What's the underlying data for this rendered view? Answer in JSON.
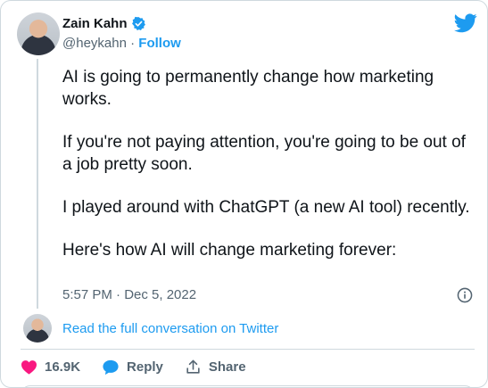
{
  "author": {
    "name": "Zain Kahn",
    "handle": "@heykahn",
    "separator": "·",
    "follow_label": "Follow"
  },
  "tweet": {
    "paragraphs": [
      "AI is going to permanently change how marketing works.",
      "If you're not paying attention, you're going to be out of a job pretty soon.",
      "I played around with ChatGPT (a new AI tool) recently.",
      "Here's how AI will change marketing forever:"
    ],
    "timestamp": "5:57 PM · Dec 5, 2022"
  },
  "conversation": {
    "link_label": "Read the full conversation on Twitter"
  },
  "actions": {
    "likes": "16.9K",
    "reply_label": "Reply",
    "share_label": "Share"
  },
  "colors": {
    "accent": "#1d9bf0",
    "like": "#f91880",
    "muted": "#536471"
  },
  "icons": [
    "verified-icon",
    "twitter-bird-icon",
    "info-icon",
    "heart-icon",
    "reply-bubble-icon",
    "share-icon"
  ]
}
